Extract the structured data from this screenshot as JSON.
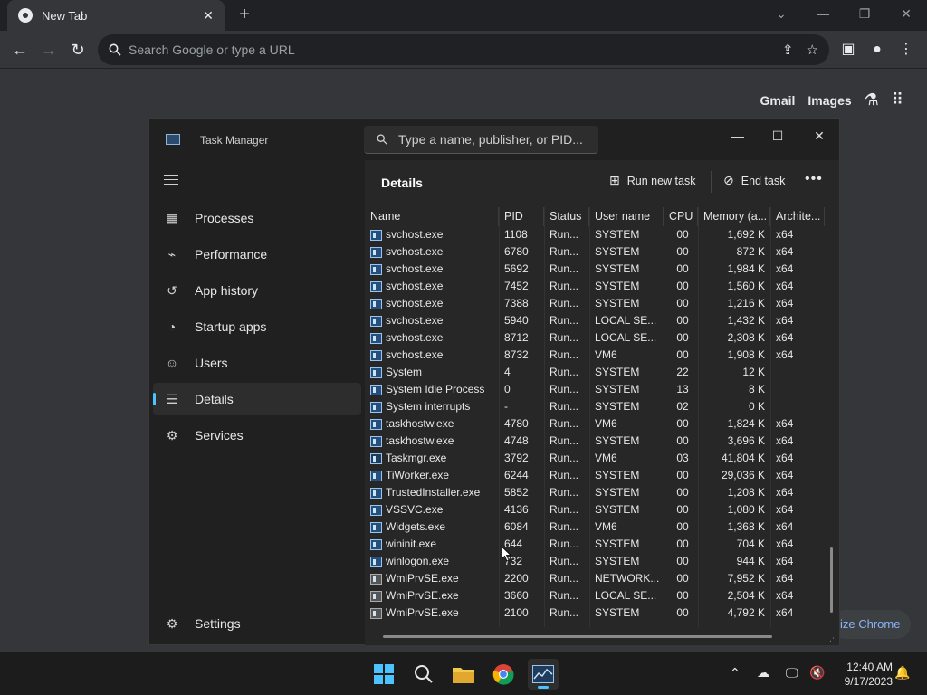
{
  "browser": {
    "tab_title": "New Tab",
    "omnibox_placeholder": "Search Google or type a URL",
    "gmail_link": "Gmail",
    "images_link": "Images",
    "customize_chip": "ize Chrome"
  },
  "task_manager": {
    "title": "Task Manager",
    "search_placeholder": "Type a name, publisher, or PID...",
    "section_title": "Details",
    "run_new_task": "Run new task",
    "end_task": "End task",
    "sidebar": {
      "items": [
        {
          "label": "Processes",
          "icon": "processes-icon"
        },
        {
          "label": "Performance",
          "icon": "performance-icon"
        },
        {
          "label": "App history",
          "icon": "history-icon"
        },
        {
          "label": "Startup apps",
          "icon": "startup-icon"
        },
        {
          "label": "Users",
          "icon": "users-icon"
        },
        {
          "label": "Details",
          "icon": "details-icon"
        },
        {
          "label": "Services",
          "icon": "services-icon"
        }
      ],
      "settings": "Settings"
    },
    "columns": [
      "Name",
      "PID",
      "Status",
      "User name",
      "CPU",
      "Memory (a...",
      "Archite..."
    ],
    "rows": [
      [
        "svchost.exe",
        "1108",
        "Run...",
        "SYSTEM",
        "00",
        "1,692 K",
        "x64"
      ],
      [
        "svchost.exe",
        "6780",
        "Run...",
        "SYSTEM",
        "00",
        "872 K",
        "x64"
      ],
      [
        "svchost.exe",
        "5692",
        "Run...",
        "SYSTEM",
        "00",
        "1,984 K",
        "x64"
      ],
      [
        "svchost.exe",
        "7452",
        "Run...",
        "SYSTEM",
        "00",
        "1,560 K",
        "x64"
      ],
      [
        "svchost.exe",
        "7388",
        "Run...",
        "SYSTEM",
        "00",
        "1,216 K",
        "x64"
      ],
      [
        "svchost.exe",
        "5940",
        "Run...",
        "LOCAL SE...",
        "00",
        "1,432 K",
        "x64"
      ],
      [
        "svchost.exe",
        "8712",
        "Run...",
        "LOCAL SE...",
        "00",
        "2,308 K",
        "x64"
      ],
      [
        "svchost.exe",
        "8732",
        "Run...",
        "VM6",
        "00",
        "1,908 K",
        "x64"
      ],
      [
        "System",
        "4",
        "Run...",
        "SYSTEM",
        "22",
        "12 K",
        ""
      ],
      [
        "System Idle Process",
        "0",
        "Run...",
        "SYSTEM",
        "13",
        "8 K",
        ""
      ],
      [
        "System interrupts",
        "-",
        "Run...",
        "SYSTEM",
        "02",
        "0 K",
        ""
      ],
      [
        "taskhostw.exe",
        "4780",
        "Run...",
        "VM6",
        "00",
        "1,824 K",
        "x64"
      ],
      [
        "taskhostw.exe",
        "4748",
        "Run...",
        "SYSTEM",
        "00",
        "3,696 K",
        "x64"
      ],
      [
        "Taskmgr.exe",
        "3792",
        "Run...",
        "VM6",
        "03",
        "41,804 K",
        "x64"
      ],
      [
        "TiWorker.exe",
        "6244",
        "Run...",
        "SYSTEM",
        "00",
        "29,036 K",
        "x64"
      ],
      [
        "TrustedInstaller.exe",
        "5852",
        "Run...",
        "SYSTEM",
        "00",
        "1,208 K",
        "x64"
      ],
      [
        "VSSVC.exe",
        "4136",
        "Run...",
        "SYSTEM",
        "00",
        "1,080 K",
        "x64"
      ],
      [
        "Widgets.exe",
        "6084",
        "Run...",
        "VM6",
        "00",
        "1,368 K",
        "x64"
      ],
      [
        "wininit.exe",
        "644",
        "Run...",
        "SYSTEM",
        "00",
        "704 K",
        "x64"
      ],
      [
        "winlogon.exe",
        "732",
        "Run...",
        "SYSTEM",
        "00",
        "944 K",
        "x64"
      ],
      [
        "WmiPrvSE.exe",
        "2200",
        "Run...",
        "NETWORK...",
        "00",
        "7,952 K",
        "x64"
      ],
      [
        "WmiPrvSE.exe",
        "3660",
        "Run...",
        "LOCAL SE...",
        "00",
        "2,504 K",
        "x64"
      ],
      [
        "WmiPrvSE.exe",
        "2100",
        "Run...",
        "SYSTEM",
        "00",
        "4,792 K",
        "x64"
      ]
    ]
  },
  "taskbar": {
    "time": "12:40 AM",
    "date": "9/17/2023"
  },
  "colors": {
    "accent": "#4cc2ff",
    "chrome_dark": "#202124",
    "tm_bg": "#272727"
  }
}
